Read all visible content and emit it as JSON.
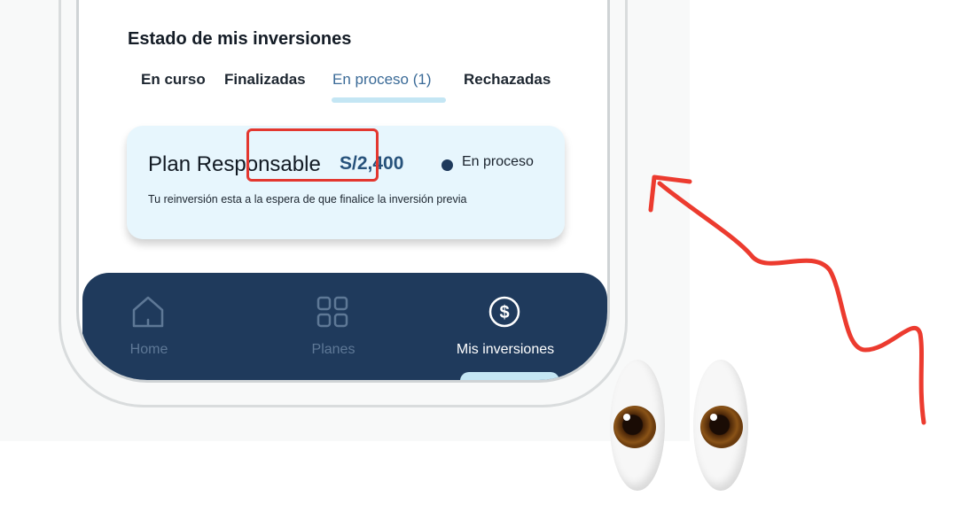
{
  "section": {
    "title": "Estado de mis inversiones"
  },
  "tabs": [
    {
      "label": "En curso"
    },
    {
      "label": "Finalizadas"
    },
    {
      "label": "En proceso (1)"
    },
    {
      "label": "Rechazadas"
    }
  ],
  "plan_card": {
    "name": "Plan Responsable",
    "amount": "S/2,400",
    "status": "En proceso",
    "description": "Tu reinversión esta a la espera de que finalice la inversión previa"
  },
  "bottom_nav": {
    "items": [
      {
        "label": "Home",
        "icon": "home-icon"
      },
      {
        "label": "Planes",
        "icon": "grid-icon"
      },
      {
        "label": "Mis inversiones",
        "icon": "dollar-circle-icon"
      }
    ],
    "active": "Mis inversiones"
  },
  "colors": {
    "navbar": "#1f3a5c",
    "card": "#e7f6fd",
    "accent": "#3a6a97",
    "highlight": "#e3372f"
  },
  "decorations": {
    "arrow": "curved-red-arrow",
    "emoji": "eyes-emoji"
  }
}
